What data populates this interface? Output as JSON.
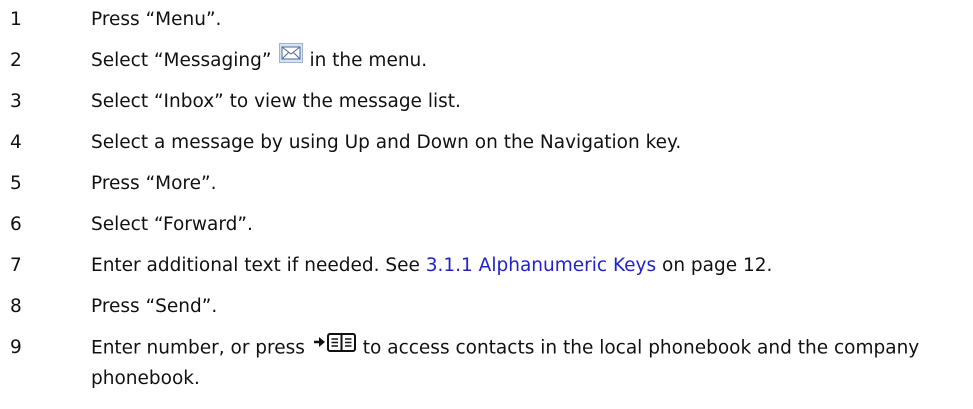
{
  "steps": [
    {
      "num": "1",
      "text": "Press “Menu”."
    },
    {
      "num": "2",
      "before": "Select “Messaging”",
      "after": "in the menu.",
      "icon": "envelope-icon"
    },
    {
      "num": "3",
      "text": "Select “Inbox” to view the message list."
    },
    {
      "num": "4",
      "text": "Select a message by using Up and Down on the Navigation key."
    },
    {
      "num": "5",
      "text": "Press “More”."
    },
    {
      "num": "6",
      "text": "Select “Forward”."
    },
    {
      "num": "7",
      "before": "Enter additional text if needed. See ",
      "link": "3.1.1 Alphanumeric Keys",
      "after": " on page 12."
    },
    {
      "num": "8",
      "text": "Press “Send”."
    },
    {
      "num": "9",
      "before": "Enter number, or press",
      "icon": "arrow-phonebook-icon",
      "after": "to access contacts in the local phonebook and the company phonebook."
    }
  ],
  "colors": {
    "text": "#111111",
    "link": "#2222cc"
  }
}
